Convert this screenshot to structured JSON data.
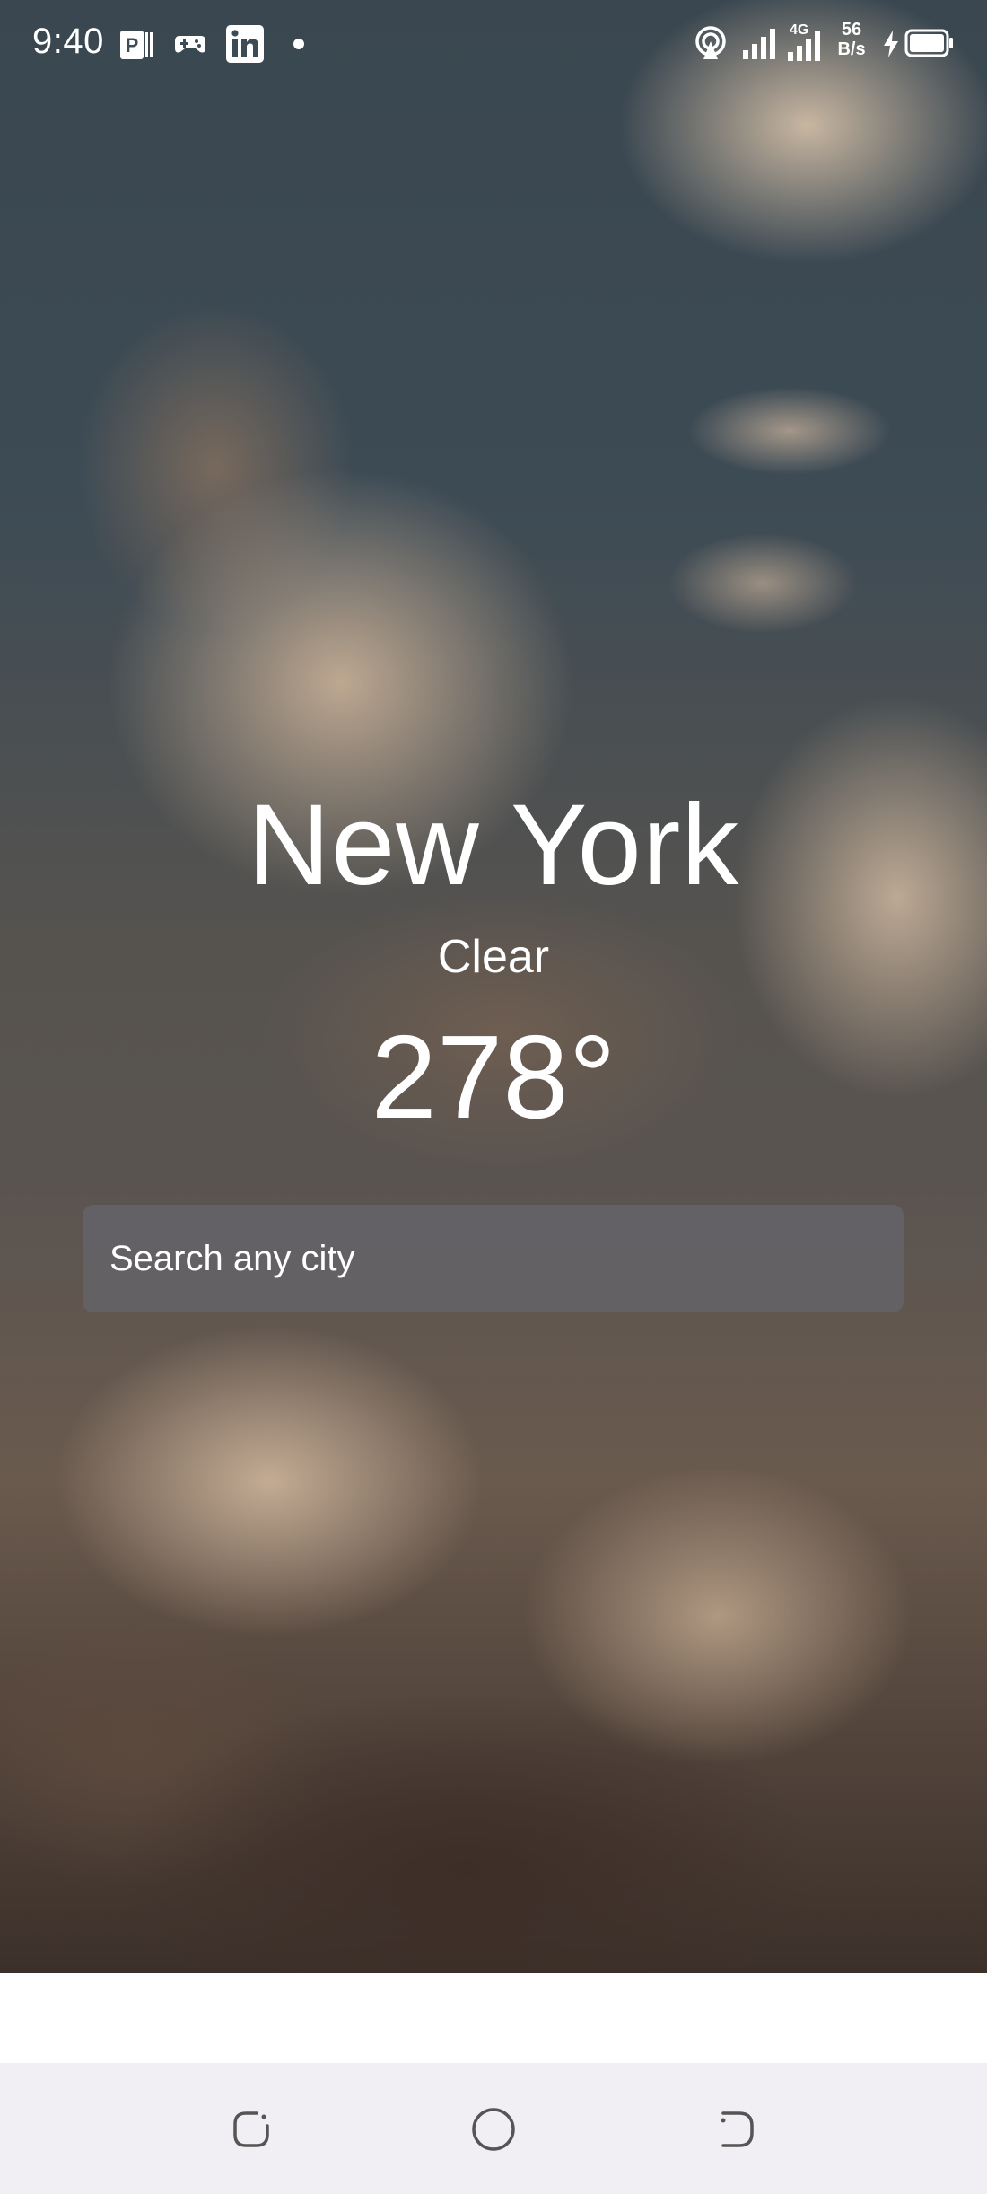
{
  "status_bar": {
    "time": "9:40",
    "net_speed_value": "56",
    "net_speed_unit": "B/s",
    "network_type": "4G",
    "icons": [
      "parking-app-icon",
      "gamepad-icon",
      "linkedin-icon",
      "notification-dot-icon",
      "hotspot-icon",
      "signal-icon",
      "signal-4g-icon",
      "charging-icon",
      "battery-icon"
    ]
  },
  "weather": {
    "city": "New York",
    "condition": "Clear",
    "temperature": "278°"
  },
  "search": {
    "placeholder": "Search any city",
    "value": ""
  },
  "nav_bar": {
    "buttons": [
      "recents-button",
      "home-button",
      "back-button"
    ]
  },
  "colors": {
    "text": "#ffffff",
    "search_bg": "#646266",
    "nav_bg": "#f1eff3",
    "nav_icon": "#555555"
  }
}
